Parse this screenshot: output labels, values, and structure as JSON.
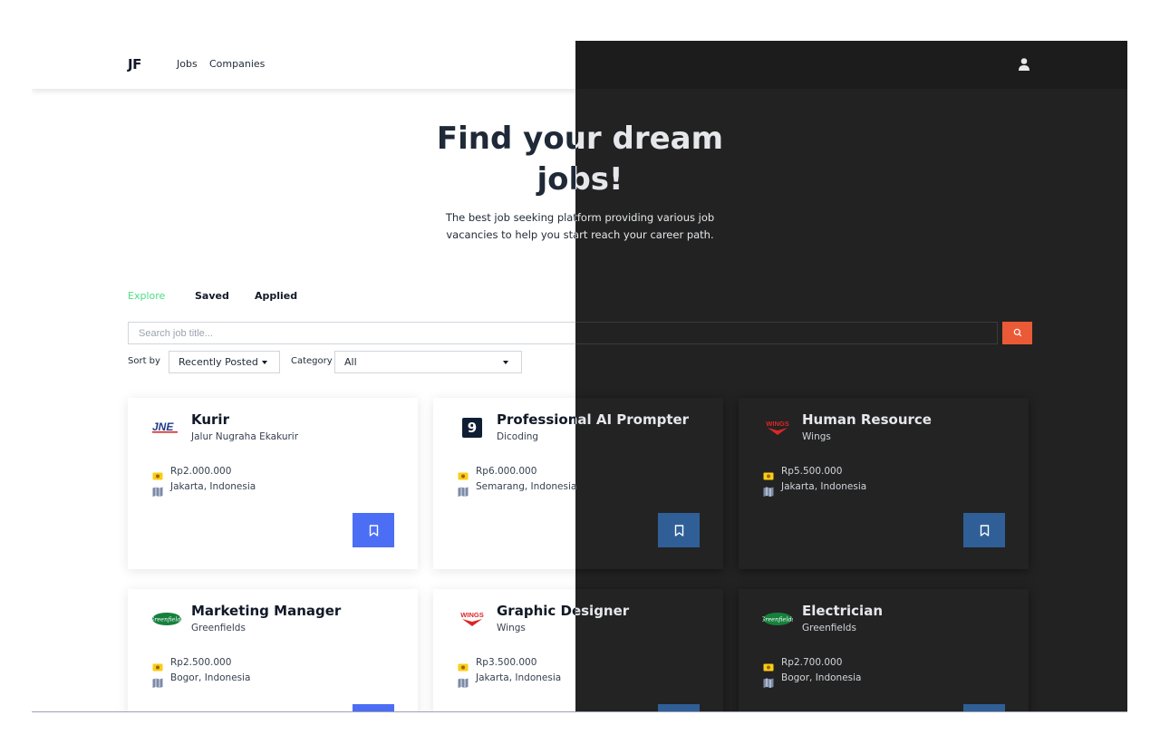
{
  "brand": {
    "logo_text": "JF"
  },
  "nav": {
    "jobs": "Jobs",
    "companies": "Companies"
  },
  "hero": {
    "title": "Find your dream jobs!",
    "subtitle": "The best job seeking platform providing various job vacancies to help you start reach your career path."
  },
  "tabs": {
    "explore": "Explore",
    "saved": "Saved",
    "applied": "Applied",
    "active": "Explore"
  },
  "search": {
    "placeholder": "Search job title...",
    "value": ""
  },
  "filters": {
    "sort_label": "Sort by",
    "sort_value": "Recently Posted",
    "category_label": "Category",
    "category_value": "All"
  },
  "jobs": [
    {
      "title": "Kurir",
      "company": "Jalur Nugraha Ekakurir",
      "salary": "Rp2.000.000",
      "location": "Jakarta, Indonesia",
      "logo": "jne-logo"
    },
    {
      "title": "Professional AI Prompter",
      "company": "Dicoding",
      "salary": "Rp6.000.000",
      "location": "Semarang, Indonesia",
      "logo": "dicoding-logo"
    },
    {
      "title": "Human Resource",
      "company": "Wings",
      "salary": "Rp5.500.000",
      "location": "Jakarta, Indonesia",
      "logo": "wings-logo"
    },
    {
      "title": "Marketing Manager",
      "company": "Greenfields",
      "salary": "Rp2.500.000",
      "location": "Bogor, Indonesia",
      "logo": "greenfields-logo"
    },
    {
      "title": "Graphic Designer",
      "company": "Wings",
      "salary": "Rp3.500.000",
      "location": "Jakarta, Indonesia",
      "logo": "wings-logo"
    },
    {
      "title": "Electrician",
      "company": "Greenfields",
      "salary": "Rp2.700.000",
      "location": "Bogor, Indonesia",
      "logo": "greenfields-logo"
    }
  ],
  "logo_text": {
    "jne": "JNE",
    "dicoding": "9",
    "wings": "WINGS",
    "greenfields": "Greenfields"
  },
  "colors": {
    "accent_green": "#4ade80",
    "search_button": "#ea5a36",
    "save_button_light": "#4c6ef5",
    "save_button_dark": "#2f5f96",
    "dark_background": "#222222"
  },
  "icons": {
    "user": "user-icon",
    "search": "search-icon",
    "salary": "money-icon",
    "location": "map-icon",
    "save": "bookmark-icon"
  }
}
